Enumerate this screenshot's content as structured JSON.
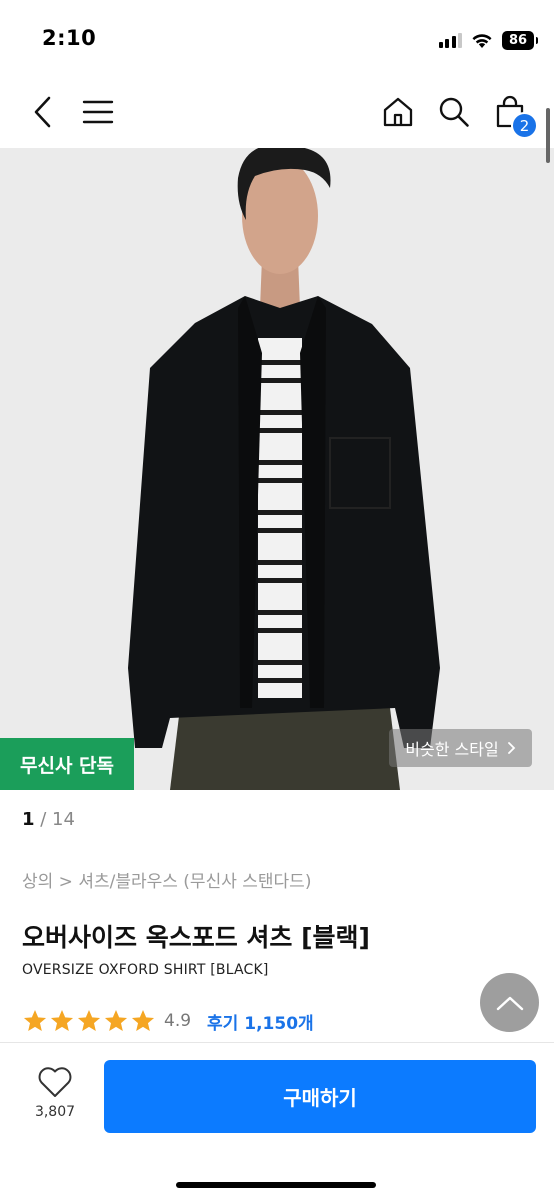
{
  "status_bar": {
    "time": "2:10",
    "battery": "86",
    "icons": [
      "cellular-signal-icon",
      "wifi-icon",
      "battery-icon"
    ]
  },
  "nav": {
    "icons": [
      "back-chevron-icon",
      "menu-icon",
      "home-icon",
      "search-icon",
      "shopping-bag-icon"
    ],
    "cart_count": "2"
  },
  "hero": {
    "exclusive_badge": "무신사 단독",
    "similar_style": "비슷한 스타일",
    "page_current": "1",
    "page_total": "/ 14"
  },
  "product": {
    "breadcrumb": "상의 > 셔츠/블라우스 (무신사 스탠다드)",
    "title": "오버사이즈 옥스포드 셔츠 [블랙]",
    "subtitle": "OVERSIZE OXFORD SHIRT [BLACK]",
    "rating_stars": 5,
    "rating": "4.9",
    "reviews": "후기 1,150개"
  },
  "bottom": {
    "like_count": "3,807",
    "buy_label": "구매하기"
  },
  "colors": {
    "accent_blue": "#0c7bff",
    "badge_green": "#1b9e5a",
    "star_orange": "#f5a623",
    "review_blue": "#1a73e8"
  }
}
